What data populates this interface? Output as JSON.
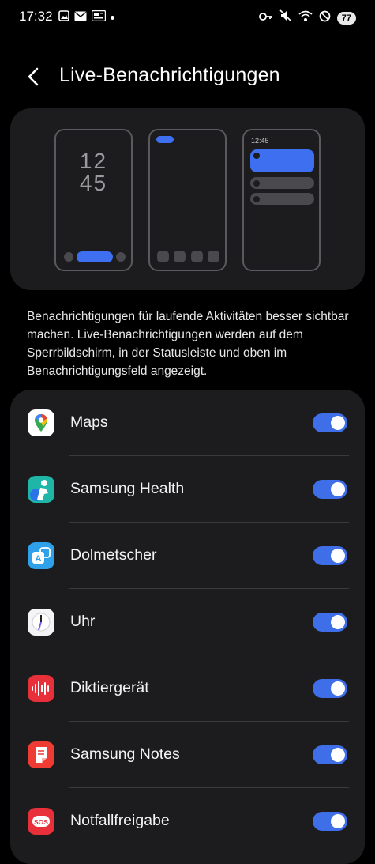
{
  "status_bar": {
    "time": "17:32",
    "left_icons": [
      "image-icon",
      "mail-icon",
      "news-icon"
    ],
    "right_icons": [
      "key-icon",
      "mute-icon",
      "wifi-icon",
      "block-icon"
    ],
    "battery": "77"
  },
  "header": {
    "title": "Live-Benachrichtigungen"
  },
  "illustration": {
    "clock_hours": "12",
    "clock_minutes": "45",
    "mini_time": "12:45"
  },
  "description": "Benachrichtigungen für laufende Aktivitäten besser sichtbar machen. Live-Benachrichtigungen werden auf dem Sperrbildschirm, in der Statusleiste und oben im Benachrichtigungsfeld angezeigt.",
  "apps": [
    {
      "label": "Maps",
      "icon": "maps-icon",
      "enabled": true
    },
    {
      "label": "Samsung Health",
      "icon": "samsung-health-icon",
      "enabled": true
    },
    {
      "label": "Dolmetscher",
      "icon": "translator-icon",
      "enabled": true
    },
    {
      "label": "Uhr",
      "icon": "clock-icon",
      "enabled": true
    },
    {
      "label": "Diktiergerät",
      "icon": "voice-recorder-icon",
      "enabled": true
    },
    {
      "label": "Samsung Notes",
      "icon": "samsung-notes-icon",
      "enabled": true
    },
    {
      "label": "Notfallfreigabe",
      "icon": "emergency-sharing-icon",
      "enabled": true,
      "icon_text": "SOS"
    }
  ],
  "colors": {
    "accent": "#3e6ee8",
    "card": "#1c1c1e",
    "background": "#000000"
  }
}
